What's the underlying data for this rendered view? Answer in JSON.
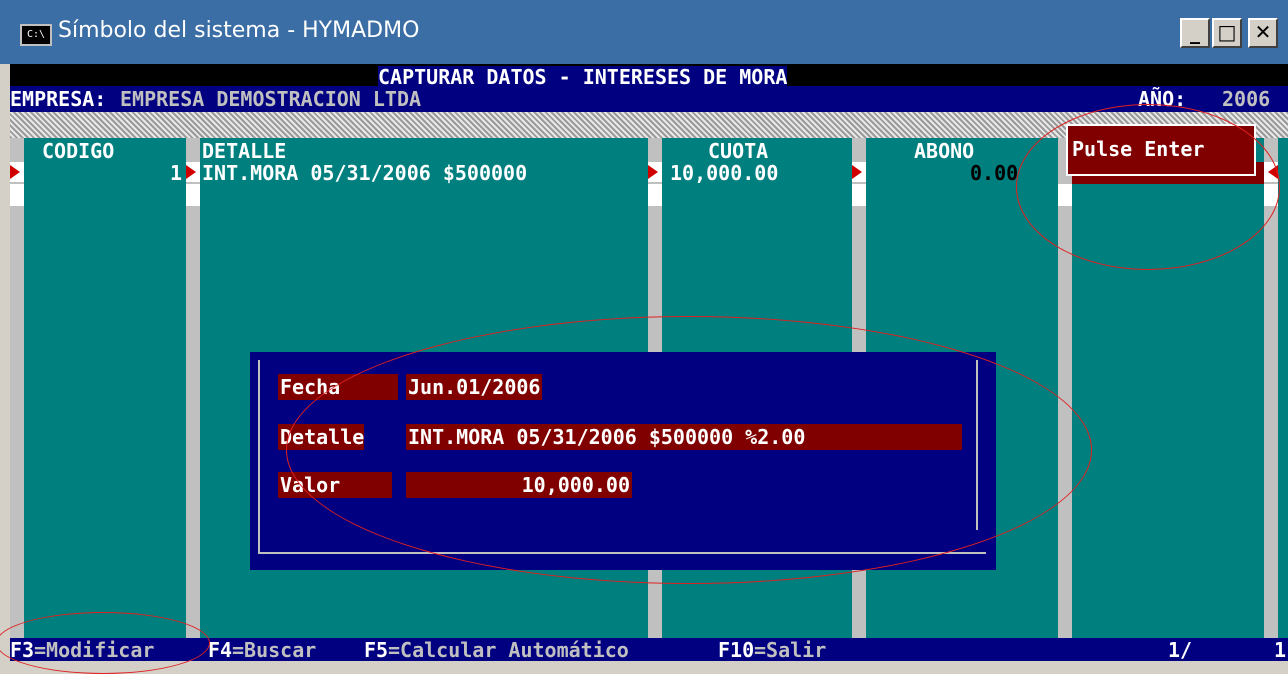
{
  "window": {
    "title": "Símbolo del sistema - HYMADMO",
    "icon": "console-icon",
    "minimize_label": "_",
    "maximize_label": "□",
    "close_label": "✕"
  },
  "header": {
    "title": "CAPTURAR DATOS - INTERESES DE MORA",
    "empresa_label": "EMPRESA:",
    "empresa_value": "EMPRESA DEMOSTRACION LTDA",
    "anio_label": "AÑO:",
    "anio_value": "2006"
  },
  "table": {
    "columns": [
      "CODIGO",
      "DETALLE",
      "CUOTA",
      "ABONO"
    ],
    "rows": [
      {
        "codigo": "1",
        "detalle": "INT.MORA 05/31/2006 $500000",
        "cuota": "10,000.00",
        "abono": "0.00"
      }
    ]
  },
  "prompt": {
    "pulse_enter": "Pulse Enter"
  },
  "dialog": {
    "fecha_label": "Fecha",
    "fecha_value": "Jun.01/2006",
    "detalle_label": "Detalle",
    "detalle_value": "INT.MORA 05/31/2006 $500000 %2.00",
    "valor_label": "Valor",
    "valor_value": "10,000.00"
  },
  "footer": {
    "f3_key": "F3",
    "f3_label": "=Modificar",
    "f4_key": "F4",
    "f4_label": "=Buscar",
    "f5_key": "F5",
    "f5_label": "=Calcular Automático",
    "f10_key": "F10",
    "f10_label": "=Salir",
    "page_indicator": "1/",
    "page_total": "1"
  },
  "colors": {
    "console_bg": "#007f7f",
    "bar_bg": "#000080",
    "field_bg": "#800000",
    "annotation": "#e02020"
  }
}
